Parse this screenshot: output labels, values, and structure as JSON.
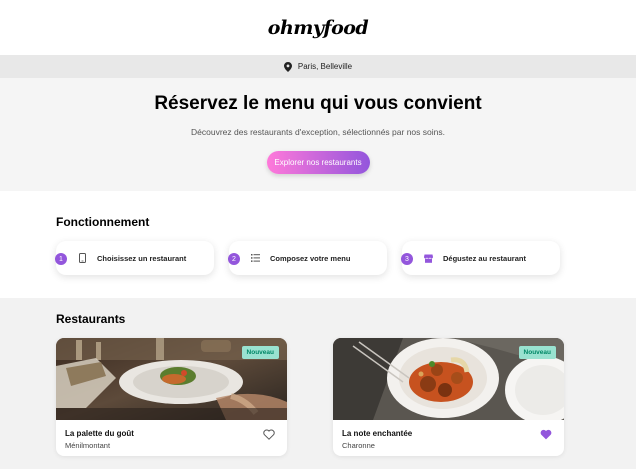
{
  "header": {
    "logo": "ohmyfood"
  },
  "location": {
    "icon": "map-pin-icon",
    "text": "Paris, Belleville"
  },
  "hero": {
    "title": "Réservez le menu qui vous convient",
    "subtitle": "Découvrez des restaurants d'exception, sélectionnés par nos soins.",
    "button_label": "Explorer nos restaurants"
  },
  "how": {
    "title": "Fonctionnement",
    "steps": [
      {
        "number": "1",
        "icon": "mobile-phone-icon",
        "label": "Choisissez un restaurant"
      },
      {
        "number": "2",
        "icon": "list-icon",
        "label": "Composez votre menu"
      },
      {
        "number": "3",
        "icon": "store-icon",
        "label": "Dégustez au restaurant"
      }
    ]
  },
  "restaurants": {
    "title": "Restaurants",
    "cards": [
      {
        "name": "La palette du goût",
        "area": "Ménilmontant",
        "badge": "Nouveau",
        "liked": false
      },
      {
        "name": "La note enchantée",
        "area": "Charonne",
        "badge": "Nouveau",
        "liked": true
      }
    ]
  },
  "colors": {
    "accent": "#9356dc",
    "gradient_start": "#ff79da",
    "badge_bg": "#99e2d0",
    "badge_text": "#008766"
  }
}
